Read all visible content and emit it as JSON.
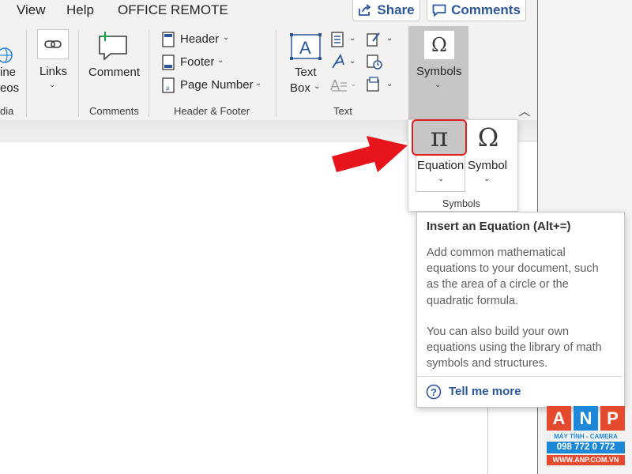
{
  "menu": {
    "view": "View",
    "help": "Help",
    "office_remote": "OFFICE REMOTE"
  },
  "topbar": {
    "share": "Share",
    "comments": "Comments"
  },
  "ribbon": {
    "media_partial_line1": "ine",
    "media_partial_line2": "eos",
    "media_group_partial": "dia",
    "links": "Links",
    "comment": "Comment",
    "header": "Header",
    "footer": "Footer",
    "page_number": "Page Number",
    "text_box_line1": "Text",
    "text_box_line2": "Box",
    "symbols": "Symbols",
    "groups": {
      "comments": "Comments",
      "header_footer": "Header & Footer",
      "text": "Text"
    }
  },
  "dropdown": {
    "equation": "Equation",
    "symbol": "Symbol",
    "group_label": "Symbols",
    "equation_glyph": "π",
    "symbol_glyph": "Ω"
  },
  "tooltip": {
    "title": "Insert an Equation (Alt+=)",
    "para1_lines": [
      "Add common mathematical",
      "equations to your document, such",
      "as the area of a circle or the",
      "quadratic formula."
    ],
    "para2_lines": [
      "You can also build your own",
      "equations using the library of math",
      "symbols and structures."
    ],
    "link": "Tell me more"
  },
  "watermark": {
    "letters": [
      "A",
      "N",
      "P"
    ],
    "tagline": "MÁY TÍNH - CAMERA",
    "phone": "098 772 0 772",
    "website": "WWW.ANP.COM.VN",
    "colors": {
      "a": "#e64a2e",
      "n": "#1e88d8",
      "p": "#e64a2e"
    }
  },
  "colors": {
    "accent_blue": "#2b579a",
    "highlight_red": "#e02020",
    "arrow_red": "#e8141c"
  }
}
